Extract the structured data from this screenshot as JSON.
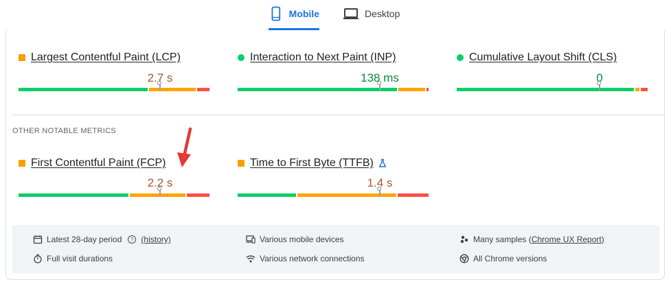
{
  "tabs": [
    {
      "label": "Mobile",
      "selected": true
    },
    {
      "label": "Desktop",
      "selected": false
    }
  ],
  "core_metrics": [
    {
      "name": "Largest Contentful Paint (LCP)",
      "value": "2.7 s",
      "status": "needs-improvement",
      "marker": "square"
    },
    {
      "name": "Interaction to Next Paint (INP)",
      "value": "138 ms",
      "status": "good",
      "marker": "circle"
    },
    {
      "name": "Cumulative Layout Shift (CLS)",
      "value": "0",
      "status": "good",
      "marker": "circle"
    }
  ],
  "section_label": "OTHER NOTABLE METRICS",
  "other_metrics": [
    {
      "name": "First Contentful Paint (FCP)",
      "value": "2.2 s",
      "status": "needs-improvement",
      "marker": "square"
    },
    {
      "name": "Time to First Byte (TTFB)",
      "value": "1.4 s",
      "status": "needs-improvement",
      "marker": "square",
      "experimental": true
    }
  ],
  "info": {
    "period": "Latest 28-day period",
    "history_link": "(history)",
    "devices": "Various mobile devices",
    "samples_prefix": "Many samples (",
    "samples_link": "Chrome UX Report",
    "samples_suffix": ")",
    "durations": "Full visit durations",
    "connections": "Various network connections",
    "versions": "All Chrome versions"
  },
  "colors": {
    "good": "#0cce6b",
    "needs_improvement": "#ffa400",
    "poor": "#ff4e42",
    "accent": "#1a73e8",
    "annotation_arrow": "#e53935"
  }
}
